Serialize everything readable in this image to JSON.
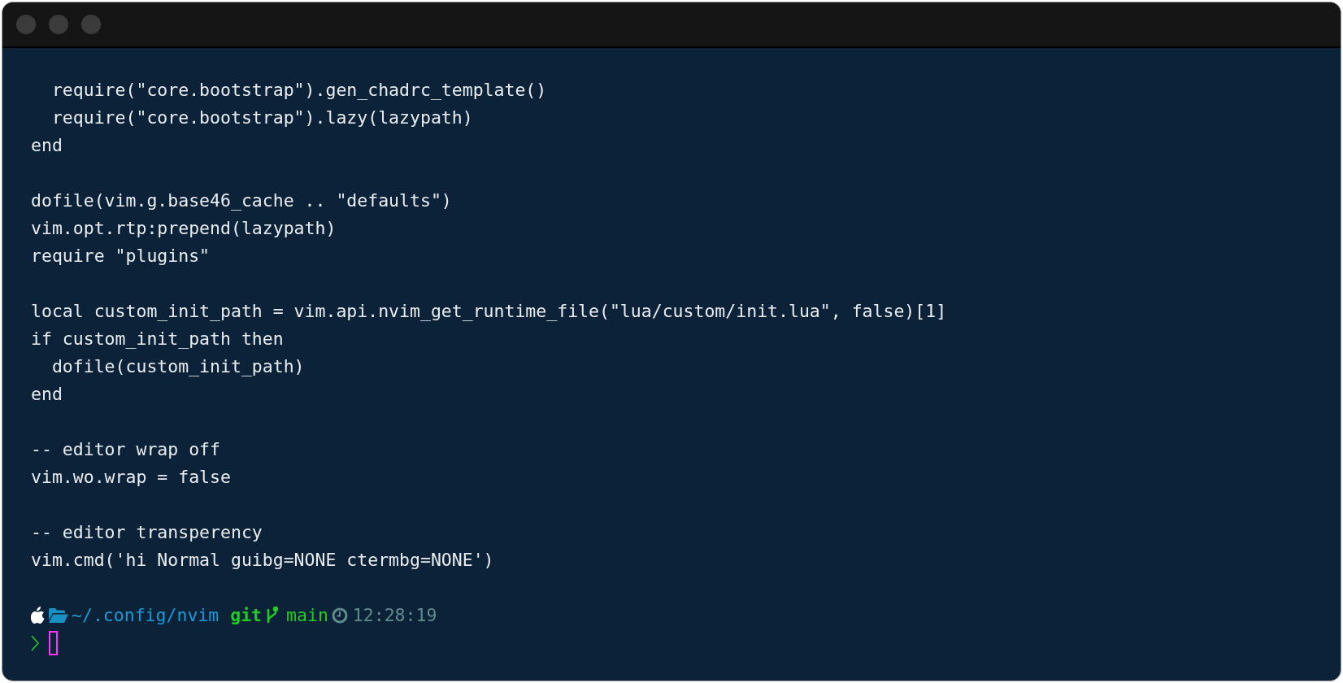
{
  "code_blocks": [
    [
      "  require(\"core.bootstrap\").gen_chadrc_template()",
      "  require(\"core.bootstrap\").lazy(lazypath)",
      "end"
    ],
    [
      "dofile(vim.g.base46_cache .. \"defaults\")",
      "vim.opt.rtp:prepend(lazypath)",
      "require \"plugins\""
    ],
    [
      "local custom_init_path = vim.api.nvim_get_runtime_file(\"lua/custom/init.lua\", false)[1]",
      "if custom_init_path then",
      "  dofile(custom_init_path)",
      "end"
    ],
    [
      "-- editor wrap off",
      "vim.wo.wrap = false"
    ],
    [
      "-- editor transperency",
      "vim.cmd('hi Normal guibg=NONE ctermbg=NONE')"
    ]
  ],
  "prompt": {
    "path": "~/.config/nvim",
    "git_label": "git",
    "branch": "main",
    "time": "12:28:19"
  }
}
